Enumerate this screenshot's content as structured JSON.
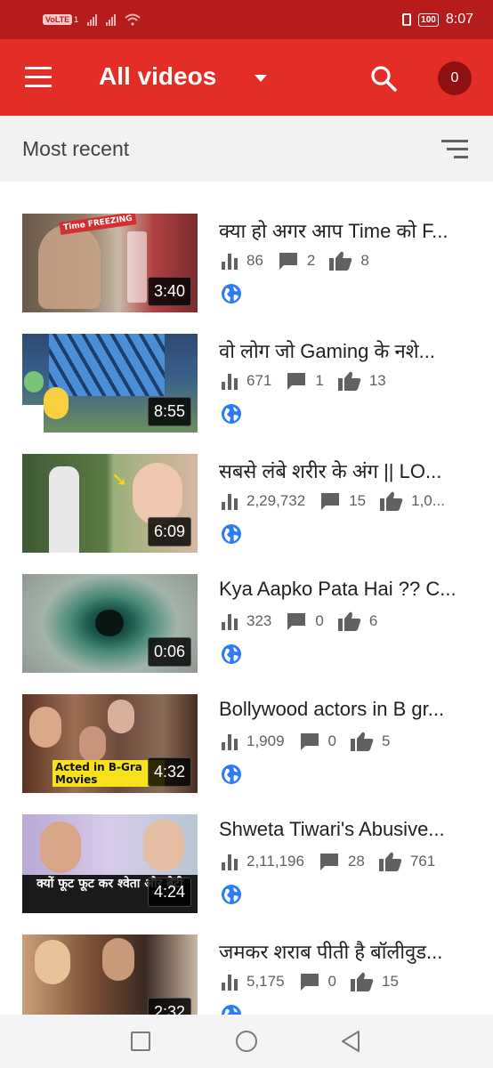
{
  "status_bar": {
    "volte": "VoLTE",
    "sim": "1",
    "battery": "100",
    "time": "8:07"
  },
  "app_bar": {
    "title": "All videos",
    "count": "0"
  },
  "sort": {
    "label": "Most recent"
  },
  "videos": [
    {
      "title": "क्या हो अगर आप Time को F...",
      "duration": "3:40",
      "views": "86",
      "comments": "2",
      "likes": "8",
      "thumb_text": "Time FREEZING"
    },
    {
      "title": "वो लोग जो  Gaming  के नशे...",
      "duration": "8:55",
      "views": "671",
      "comments": "1",
      "likes": "13",
      "thumb_text": ""
    },
    {
      "title": "सबसे लंबे शरीर के अंग || LO...",
      "duration": "6:09",
      "views": "2,29,732",
      "comments": "15",
      "likes": "1,0...",
      "thumb_text": ""
    },
    {
      "title": "Kya Aapko Pata Hai ?? C...",
      "duration": "0:06",
      "views": "323",
      "comments": "0",
      "likes": "6",
      "thumb_text": ""
    },
    {
      "title": "Bollywood actors in B gr...",
      "duration": "4:32",
      "views": "1,909",
      "comments": "0",
      "likes": "5",
      "thumb_text": "Acted in B-Gra Movies"
    },
    {
      "title": "Shweta Tiwari's Abusive...",
      "duration": "4:24",
      "views": "2,11,196",
      "comments": "28",
      "likes": "761",
      "thumb_text": "क्यों फूट फूट कर श्वेता और बेटी"
    },
    {
      "title": "जमकर शराब पीती है बॉलीवुड...",
      "duration": "2:32",
      "views": "5,175",
      "comments": "0",
      "likes": "15",
      "thumb_text": ""
    }
  ],
  "colors": {
    "status_bar": "#b71c1c",
    "app_bar": "#e52d27",
    "badge": "#8e1010",
    "globe": "#2d7cf6",
    "stat_icon": "#616161"
  }
}
